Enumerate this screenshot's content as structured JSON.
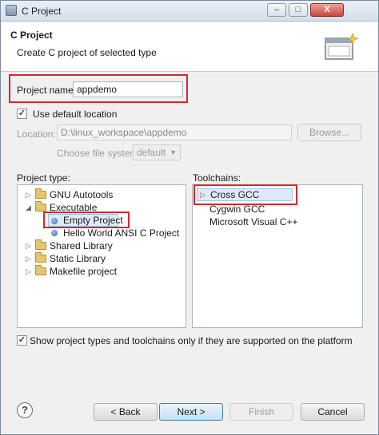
{
  "window": {
    "title": "C Project",
    "min": "–",
    "max": "□",
    "close": "X"
  },
  "header": {
    "title": "C Project",
    "description": "Create C project of selected type"
  },
  "project": {
    "name_label": "Project name:",
    "name_value": "appdemo"
  },
  "location": {
    "use_default_label": "Use default location",
    "use_default_checked": "✓",
    "label": "Location:",
    "value": "D:\\linux_workspace\\appdemo",
    "browse_label": "Browse...",
    "filesystem_label": "Choose file system:",
    "filesystem_value": "default"
  },
  "project_types": {
    "label": "Project type:",
    "items": [
      {
        "label": "GNU Autotools",
        "expander": "▷"
      },
      {
        "label": "Executable",
        "expander": "◢"
      },
      {
        "label": "Empty Project"
      },
      {
        "label": "Hello World ANSI C Project"
      },
      {
        "label": "Shared Library",
        "expander": "▷"
      },
      {
        "label": "Static Library",
        "expander": "▷"
      },
      {
        "label": "Makefile project",
        "expander": "▷"
      }
    ]
  },
  "toolchains": {
    "label": "Toolchains:",
    "items": [
      {
        "label": "Cross GCC",
        "marker": "▷"
      },
      {
        "label": "Cygwin GCC"
      },
      {
        "label": "Microsoft Visual C++"
      }
    ]
  },
  "filter": {
    "label": "Show project types and toolchains only if they are supported on the platform",
    "checked": "✓"
  },
  "buttons": {
    "help": "?",
    "back": "< Back",
    "next": "Next >",
    "finish": "Finish",
    "cancel": "Cancel"
  },
  "colors": {
    "highlight": "#d8262b",
    "selection": "#dfe9f7"
  }
}
